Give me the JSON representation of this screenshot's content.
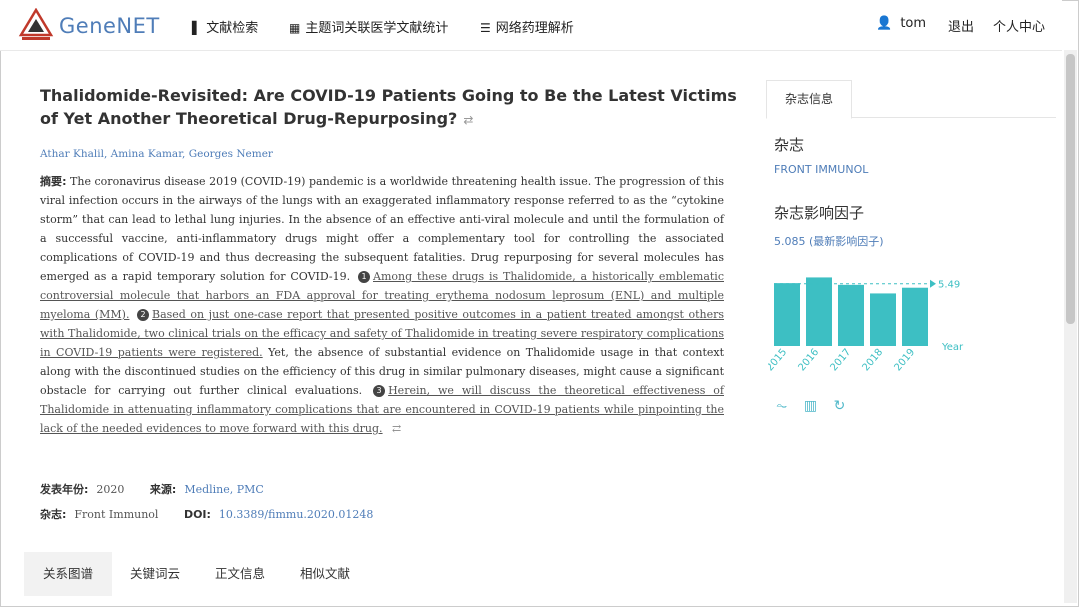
{
  "header": {
    "logo_text": "GeneNET",
    "nav": [
      {
        "icon": "document-icon",
        "label": "文献检索"
      },
      {
        "icon": "grid-icon",
        "label": "主题词关联医学文献统计"
      },
      {
        "icon": "list-icon",
        "label": "网络药理解析"
      }
    ],
    "user_name": "tom",
    "logout_label": "退出",
    "profile_label": "个人中心"
  },
  "article": {
    "title": "Thalidomide-Revisited: Are COVID-19 Patients Going to Be the Latest Victims of Yet Another Theoretical Drug-Repurposing?",
    "title_icon": "⇄",
    "authors": "Athar Khalil, Amina Kamar, Georges Nemer",
    "abstract_label": "摘要:",
    "abstract_intro": "The coronavirus disease 2019 (COVID-19) pandemic is a worldwide threatening health issue. The progression of this viral infection occurs in the airways of the lungs with an exaggerated inflammatory response referred to as the “cytokine storm” that can lead to lethal lung injuries. In the absence of an effective anti-viral molecule and until the formulation of a successful vaccine, anti-inflammatory drugs might offer a complementary tool for controlling the associated complications of COVID-19 and thus decreasing the subsequent fatalities. Drug repurposing for several molecules has emerged as a rapid temporary solution for COVID-19.",
    "highlights": [
      {
        "num": "1",
        "text": "Among these drugs is Thalidomide, a historically emblematic controversial molecule that harbors an FDA approval for treating erythema nodosum leprosum (ENL) and multiple myeloma (MM)."
      },
      {
        "num": "2",
        "text": "Based on just one-case report that presented positive outcomes in a patient treated amongst others with Thalidomide, two clinical trials on the efficacy and safety of Thalidomide in treating severe respiratory complications in COVID-19 patients were registered."
      },
      {
        "num": "3",
        "text": "Herein, we will discuss the theoretical effectiveness of Thalidomide in attenuating inflammatory complications that are encountered in COVID-19 patients while pinpointing the lack of the needed evidences to move forward with this drug."
      }
    ],
    "abstract_mid": "Yet, the absence of substantial evidence on Thalidomide usage in that context along with the discontinued studies on the efficiency of this drug in similar pulmonary diseases, might cause a significant obstacle for carrying out further clinical evaluations.",
    "abstract_end_icon": "⇄",
    "year_label": "发表年份:",
    "year": "2020",
    "source_label": "来源:",
    "source": "Medline, PMC",
    "journal_label": "杂志:",
    "journal": "Front Immunol",
    "doi_label": "DOI:",
    "doi": "10.3389/fimmu.2020.01248"
  },
  "tabs": [
    "关系图谱",
    "关键词云",
    "正文信息",
    "相似文献"
  ],
  "sidebar": {
    "tab_label": "杂志信息",
    "journal_heading": "杂志",
    "journal_name": "FRONT IMMUNOL",
    "if_heading": "杂志影响因子",
    "if_value": "5.085 (最新影响因子)"
  },
  "chart_data": {
    "type": "bar",
    "categories": [
      "2015",
      "2016",
      "2017",
      "2018",
      "2019"
    ],
    "values": [
      5.5,
      6.0,
      5.35,
      4.6,
      5.1
    ],
    "annotation": "5.49",
    "xlabel": "Year",
    "color": "#3dbfc3",
    "ylim": [
      0,
      7
    ]
  }
}
